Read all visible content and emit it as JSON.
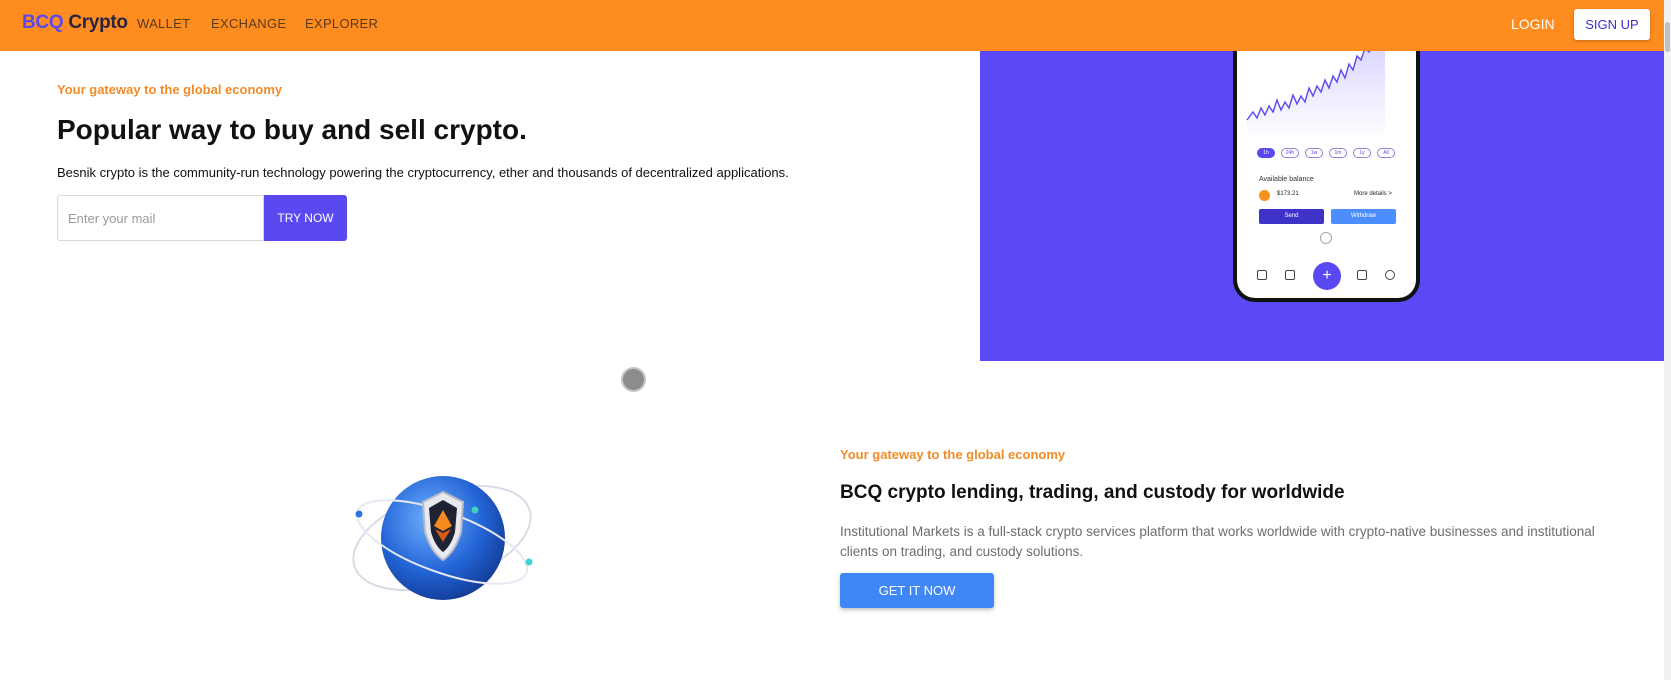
{
  "header": {
    "logo_part1": "BCQ",
    "logo_part2": "Crypto",
    "nav": [
      "WALLET",
      "EXCHANGE",
      "EXPLORER"
    ],
    "login": "LOGIN",
    "signup": "SIGN UP"
  },
  "hero": {
    "eyebrow": "Your gateway to the global economy",
    "title": "Popular way to buy and sell crypto.",
    "description": "Besnik crypto is the community-run technology powering the cryptocurrency, ether and thousands of decentralized applications.",
    "email_placeholder": "Enter your mail",
    "cta": "TRY NOW"
  },
  "phone": {
    "ranges": [
      "1h",
      "24h",
      "1w",
      "1m",
      "1y",
      "All"
    ],
    "balance_label": "Available balance",
    "balance_value": "$173.21",
    "more_details": "More details >",
    "send": "Send",
    "withdraw": "Withdraw",
    "plus": "+"
  },
  "section2": {
    "eyebrow": "Your gateway to the global economy",
    "title": "BCQ crypto lending, trading, and custody for worldwide",
    "description": "Institutional Markets is a full-stack crypto services platform that works worldwide with crypto-native businesses and institutional clients on trading, and custody solutions.",
    "cta": "GET IT NOW"
  },
  "colors": {
    "header": "#ff8c1f",
    "accent": "#5a49f0",
    "eyebrow": "#f08c28",
    "panel": "#5a49f5",
    "button_blue": "#3f87f5"
  },
  "icons": [
    "home-icon",
    "bookmark-icon",
    "plus-icon",
    "chart-icon",
    "user-icon",
    "bitcoin-icon",
    "play-icon",
    "ethereum-shield-icon",
    "globe-icon"
  ]
}
